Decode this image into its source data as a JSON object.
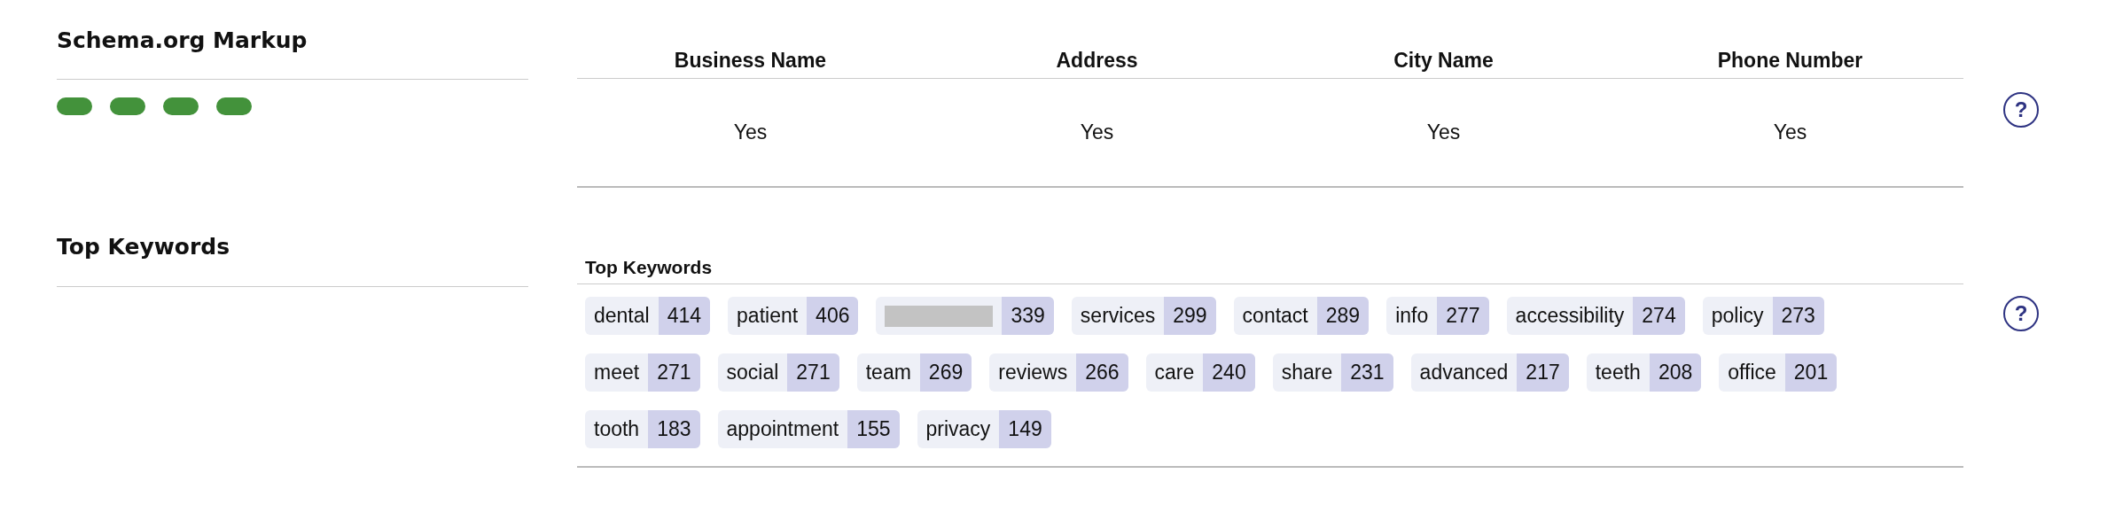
{
  "sections": [
    {
      "kind": "schema",
      "title": "Schema.org Markup",
      "status_pills": [
        {
          "color": "#43923b"
        },
        {
          "color": "#43923b"
        },
        {
          "color": "#43923b"
        },
        {
          "color": "#43923b"
        }
      ],
      "table": {
        "columns": [
          "Business Name",
          "Address",
          "City Name",
          "Phone Number"
        ],
        "rows": [
          [
            "Yes",
            "Yes",
            "Yes",
            "Yes"
          ]
        ]
      },
      "help": "?"
    },
    {
      "kind": "keywords",
      "title": "Top Keywords",
      "label": "Top Keywords",
      "keywords": [
        {
          "kind": "word",
          "word": "dental",
          "count": "414"
        },
        {
          "kind": "word",
          "word": "patient",
          "count": "406"
        },
        {
          "kind": "redacted",
          "count": "339"
        },
        {
          "kind": "word",
          "word": "services",
          "count": "299"
        },
        {
          "kind": "word",
          "word": "contact",
          "count": "289"
        },
        {
          "kind": "word",
          "word": "info",
          "count": "277"
        },
        {
          "kind": "word",
          "word": "accessibility",
          "count": "274"
        },
        {
          "kind": "word",
          "word": "policy",
          "count": "273"
        },
        {
          "kind": "word",
          "word": "meet",
          "count": "271"
        },
        {
          "kind": "word",
          "word": "social",
          "count": "271"
        },
        {
          "kind": "word",
          "word": "team",
          "count": "269"
        },
        {
          "kind": "word",
          "word": "reviews",
          "count": "266"
        },
        {
          "kind": "word",
          "word": "care",
          "count": "240"
        },
        {
          "kind": "word",
          "word": "share",
          "count": "231"
        },
        {
          "kind": "word",
          "word": "advanced",
          "count": "217"
        },
        {
          "kind": "word",
          "word": "teeth",
          "count": "208"
        },
        {
          "kind": "word",
          "word": "office",
          "count": "201"
        },
        {
          "kind": "word",
          "word": "tooth",
          "count": "183"
        },
        {
          "kind": "word",
          "word": "appointment",
          "count": "155"
        },
        {
          "kind": "word",
          "word": "privacy",
          "count": "149"
        }
      ],
      "help": "?"
    }
  ]
}
